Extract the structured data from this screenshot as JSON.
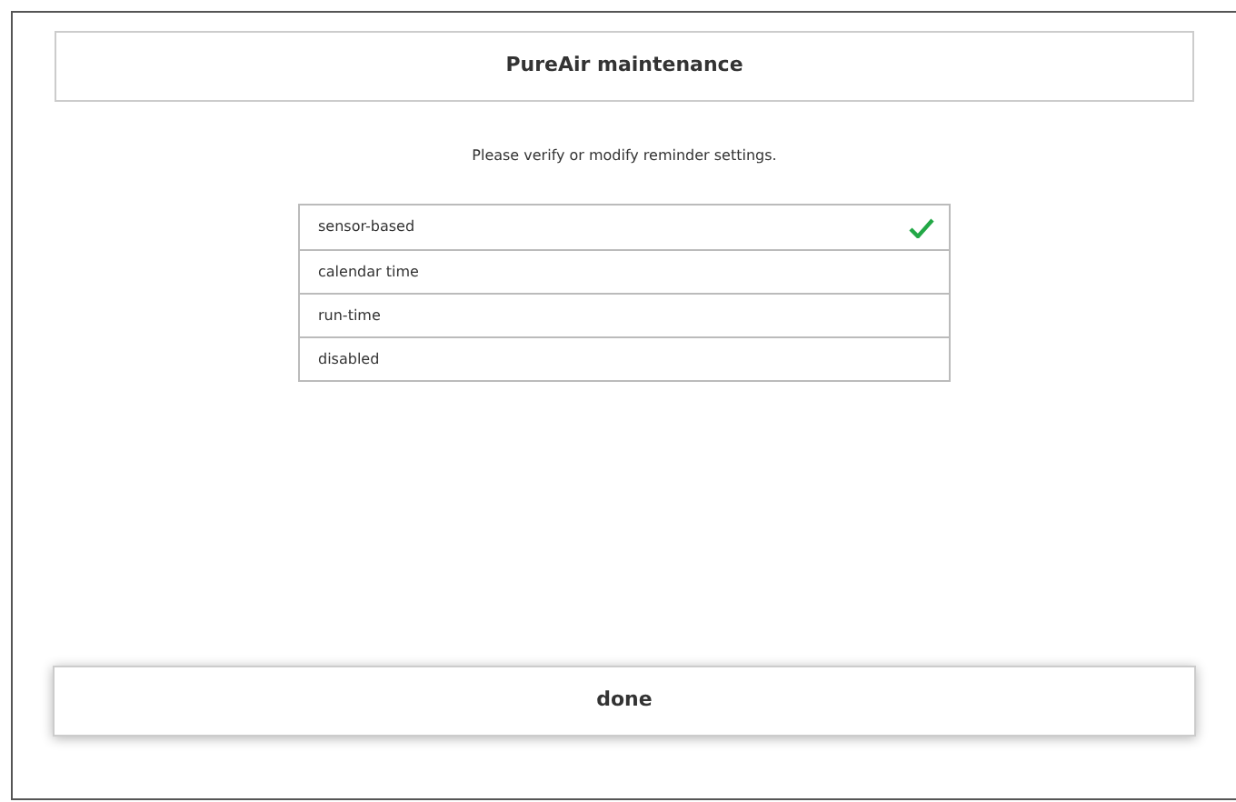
{
  "header": {
    "title": "PureAir maintenance"
  },
  "instruction": "Please verify or modify reminder settings.",
  "options": [
    {
      "label": "sensor-based",
      "selected": true
    },
    {
      "label": "calendar time",
      "selected": false
    },
    {
      "label": "run-time",
      "selected": false
    },
    {
      "label": "disabled",
      "selected": false
    }
  ],
  "done_button": {
    "label": "done"
  }
}
